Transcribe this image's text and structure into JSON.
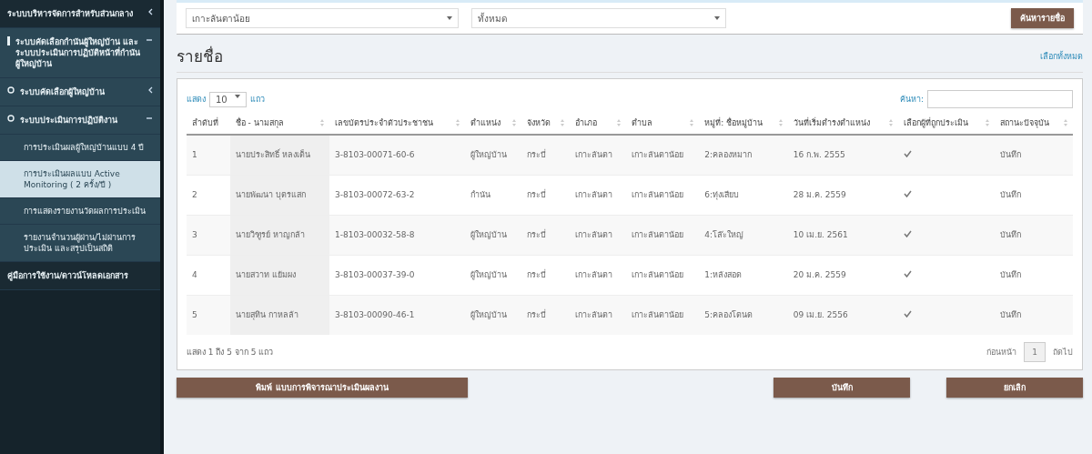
{
  "sidebar": {
    "items": [
      {
        "label": "ระบบบริหารจัดการสำหรับส่วนกลาง",
        "kind": "menu",
        "expanded": false
      },
      {
        "label": "ระบบคัดเลือกกำนันผู้ใหญ่บ้าน และระบบประเมินการปฏิบัติหน้าที่กำนันผู้ใหญ่บ้าน",
        "kind": "menu",
        "expanded": true,
        "children": [
          {
            "label": "ระบบคัดเลือกผู้ใหญ่บ้าน",
            "kind": "menu",
            "expanded": false
          },
          {
            "label": "ระบบประเมินการปฏิบัติงาน",
            "kind": "menu",
            "expanded": true,
            "children": [
              {
                "label": "การประเมินผลผู้ใหญ่บ้านแบบ 4 ปี",
                "selected": false
              },
              {
                "label": "การประเมินผลแบบ Active Monitoring ( 2 ครั้ง/ปี )",
                "selected": true
              },
              {
                "label": "การแสดงรายงานวัดผลการประเมิน",
                "selected": false
              },
              {
                "label": "รายงานจำนวนผู้ผ่าน/ไม่ผ่านการประเมิน และสรุปเป็นสถิติ",
                "selected": false
              }
            ]
          }
        ]
      },
      {
        "label": "คู่มือการใช้งาน/ดาวน์โหลดเอกสาร",
        "kind": "link",
        "expanded": false
      }
    ]
  },
  "filters": {
    "selects": [
      "เกาะลันตาน้อย",
      "ทั้งหมด"
    ],
    "button": "ค้นหารายชื่อ"
  },
  "heading": "รายชื่อ",
  "select_all": "เลือกทั้งหมด",
  "table": {
    "length_label_before": "แสดง",
    "length_value": "10",
    "length_label_after": "แถว",
    "search_label": "ค้นหา:",
    "columns": [
      "ลำดับที่",
      "ชื่อ - นามสกุล",
      "เลขบัตรประจำตัวประชาชน",
      "ตำแหน่ง",
      "จังหวัด",
      "อำเภอ",
      "ตำบล",
      "หมู่ที่: ชื่อหมู่บ้าน",
      "วันที่เริ่มดำรงตำแหน่ง",
      "เลือกผู้ที่ถูกประเมิน",
      "สถานะปัจจุบัน"
    ],
    "rows": [
      {
        "cells": [
          "1",
          "นายประสิทธิ์ หลงเต็น",
          "3-8103-00071-60-6",
          "ผู้ใหญ่บ้าน",
          "กระบี่",
          "เกาะลันตา",
          "เกาะลันตาน้อย",
          "2:คลองหมาก",
          "16 ก.พ. 2555"
        ],
        "selected": true,
        "status": "บันทึก"
      },
      {
        "cells": [
          "2",
          "นายพัฒนา บุตรแสก",
          "3-8103-00072-63-2",
          "กำนัน",
          "กระบี่",
          "เกาะลันตา",
          "เกาะลันตาน้อย",
          "6:ทุ่งเสียบ",
          "28 ม.ค. 2559"
        ],
        "selected": true,
        "status": "บันทึก"
      },
      {
        "cells": [
          "3",
          "นายวิฑูรย์ หาญกล้า",
          "1-8103-00032-58-8",
          "ผู้ใหญ่บ้าน",
          "กระบี่",
          "เกาะลันตา",
          "เกาะลันตาน้อย",
          "4:โล๊ะใหญ่",
          "10 เม.ย. 2561"
        ],
        "selected": true,
        "status": "บันทึก"
      },
      {
        "cells": [
          "4",
          "นายสวาท แย้มผง",
          "3-8103-00037-39-0",
          "ผู้ใหญ่บ้าน",
          "กระบี่",
          "เกาะลันตา",
          "เกาะลันตาน้อย",
          "1:หลังสอด",
          "20 ม.ค. 2559"
        ],
        "selected": true,
        "status": "บันทึก"
      },
      {
        "cells": [
          "5",
          "นายสุทิน กาหลล้า",
          "3-8103-00090-46-1",
          "ผู้ใหญ่บ้าน",
          "กระบี่",
          "เกาะลันตา",
          "เกาะลันตาน้อย",
          "5:คลองโตนด",
          "09 เม.ย. 2556"
        ],
        "selected": true,
        "status": "บันทึก"
      }
    ],
    "info": "แสดง 1 ถึง 5 จาก 5 แถว",
    "pages": [
      {
        "label": "ก่อนหน้า",
        "kind": "prev"
      },
      {
        "label": "1",
        "kind": "page",
        "selected": true
      },
      {
        "label": "ถัดไป",
        "kind": "next"
      }
    ]
  },
  "actions": [
    {
      "label": "พิมพ์ แบบการพิจารณาประเมินผลงาน",
      "kind": "wide"
    },
    {
      "label": "บันทึก",
      "kind": "normal"
    },
    {
      "label": "ยกเลิก",
      "kind": "normal"
    }
  ]
}
